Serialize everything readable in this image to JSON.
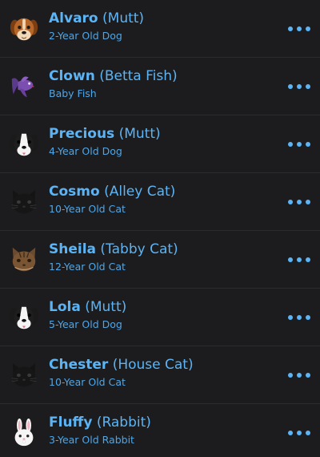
{
  "pets": [
    {
      "name": "Alvaro",
      "breed": "(Mutt)",
      "subtitle": "2-Year Old Dog",
      "icon": "brown-dog-icon"
    },
    {
      "name": "Clown",
      "breed": "(Betta Fish)",
      "subtitle": "Baby Fish",
      "icon": "betta-fish-icon"
    },
    {
      "name": "Precious",
      "breed": "(Mutt)",
      "subtitle": "4-Year Old Dog",
      "icon": "black-white-dog-icon"
    },
    {
      "name": "Cosmo",
      "breed": "(Alley Cat)",
      "subtitle": "10-Year Old Cat",
      "icon": "black-cat-icon"
    },
    {
      "name": "Sheila",
      "breed": "(Tabby Cat)",
      "subtitle": "12-Year Old Cat",
      "icon": "tabby-cat-icon"
    },
    {
      "name": "Lola",
      "breed": "(Mutt)",
      "subtitle": "5-Year Old Dog",
      "icon": "black-white-dog-icon"
    },
    {
      "name": "Chester",
      "breed": "(House Cat)",
      "subtitle": "10-Year Old Cat",
      "icon": "black-cat-icon"
    },
    {
      "name": "Fluffy",
      "breed": "(Rabbit)",
      "subtitle": "3-Year Old Rabbit",
      "icon": "white-rabbit-icon"
    }
  ],
  "colors": {
    "background": "#1c1c1e",
    "accent": "#5bb4f5",
    "divider": "#2c2c2e"
  },
  "more_icon": "more-horizontal-icon"
}
